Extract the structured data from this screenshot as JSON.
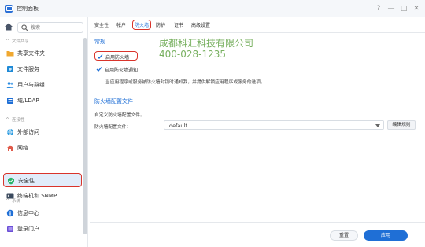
{
  "window": {
    "title": "控制面板",
    "controls": {
      "help": "?",
      "minimize": "—",
      "maximize": "□",
      "close": "✕"
    }
  },
  "sidebar": {
    "search_placeholder": "搜索",
    "groups": [
      {
        "label": "文件共享"
      },
      {
        "label": "连接性"
      },
      {
        "label": "系统"
      }
    ],
    "items": [
      {
        "label": "共享文件夹",
        "icon": "folder-icon"
      },
      {
        "label": "文件服务",
        "icon": "file-service-icon"
      },
      {
        "label": "用户与群组",
        "icon": "users-icon"
      },
      {
        "label": "域/LDAP",
        "icon": "domain-icon"
      },
      {
        "label": "外部访问",
        "icon": "globe-icon"
      },
      {
        "label": "网络",
        "icon": "network-icon"
      },
      {
        "label": "安全性",
        "icon": "shield-icon",
        "active": true
      },
      {
        "label": "终端机和 SNMP",
        "icon": "terminal-icon"
      },
      {
        "label": "信息中心",
        "icon": "info-icon"
      },
      {
        "label": "登录门户",
        "icon": "portal-icon"
      }
    ]
  },
  "tabs": [
    {
      "label": "安全性"
    },
    {
      "label": "帐户"
    },
    {
      "label": "防火墙",
      "active": true
    },
    {
      "label": "防护"
    },
    {
      "label": "证书"
    },
    {
      "label": "高级设置"
    }
  ],
  "general": {
    "title": "常规",
    "enable_firewall": {
      "label": "启用防火墙",
      "checked": true
    },
    "enable_notify": {
      "label": "启用防火墙通知",
      "checked": true
    },
    "notify_desc": "当应用程序或服务被防火墙封锁时通知我，并提供解锁应用程序或服务的选项。"
  },
  "profile": {
    "title": "防火墙配置文件",
    "desc": "自定义防火墙配置文件。",
    "field_label": "防火墙配置文件：",
    "selected": "default",
    "edit_button": "编辑规则"
  },
  "watermark": {
    "line1": "成都科汇科技有限公司",
    "line2": "400-028-1235"
  },
  "footer": {
    "reset": "重置",
    "apply": "应用"
  },
  "colors": {
    "accent": "#1f6fd6",
    "highlight": "#d9342b",
    "watermark": "#6aa84f"
  }
}
